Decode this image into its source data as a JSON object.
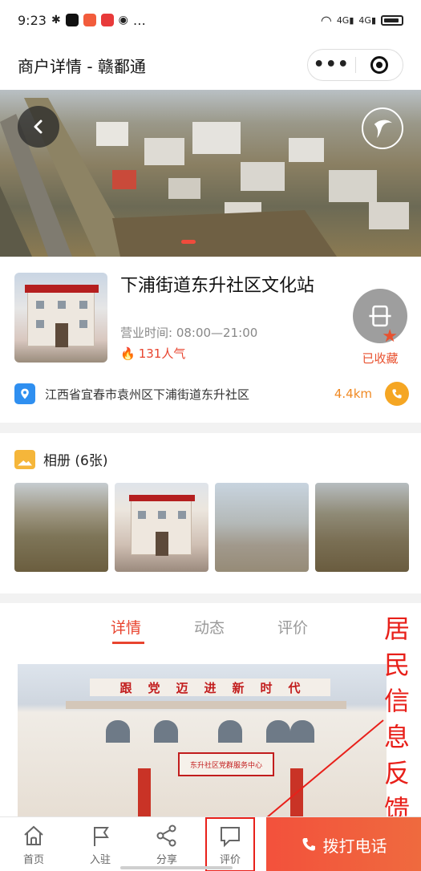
{
  "status_bar": {
    "time": "9:23",
    "extras": "…",
    "signal_1": "4G",
    "signal_2": "4G"
  },
  "nav": {
    "title": "商户详情 - 赣鄱通",
    "more_label": "•••"
  },
  "shop": {
    "name": "下浦街道东升社区文化站",
    "hours": "营业时间: 08:00—21:00",
    "popularity": "131人气",
    "favorite_label": "已收藏",
    "address": "江西省宜春市袁州区下浦街道东升社区",
    "distance": "4.4km"
  },
  "album": {
    "title": "相册 (6张)"
  },
  "tabs": [
    {
      "label": "详情",
      "active": true
    },
    {
      "label": "动态",
      "active": false
    },
    {
      "label": "评价",
      "active": false
    }
  ],
  "content": {
    "slogan": "跟党迈进新时代",
    "sign": "东升社区党群服务中心"
  },
  "annotation": {
    "chars": [
      "居",
      "民",
      "信",
      "息",
      "反",
      "馈"
    ]
  },
  "bottom_bar": {
    "home": "首页",
    "join": "入驻",
    "share": "分享",
    "review": "评价",
    "call": "拨打电话"
  },
  "colors": {
    "accent": "#e8442f",
    "call_button": "#f3513c",
    "favorite": "#e8512f",
    "distance": "#f08a24",
    "location": "#2f8ff0",
    "annotation": "#e8201a"
  }
}
